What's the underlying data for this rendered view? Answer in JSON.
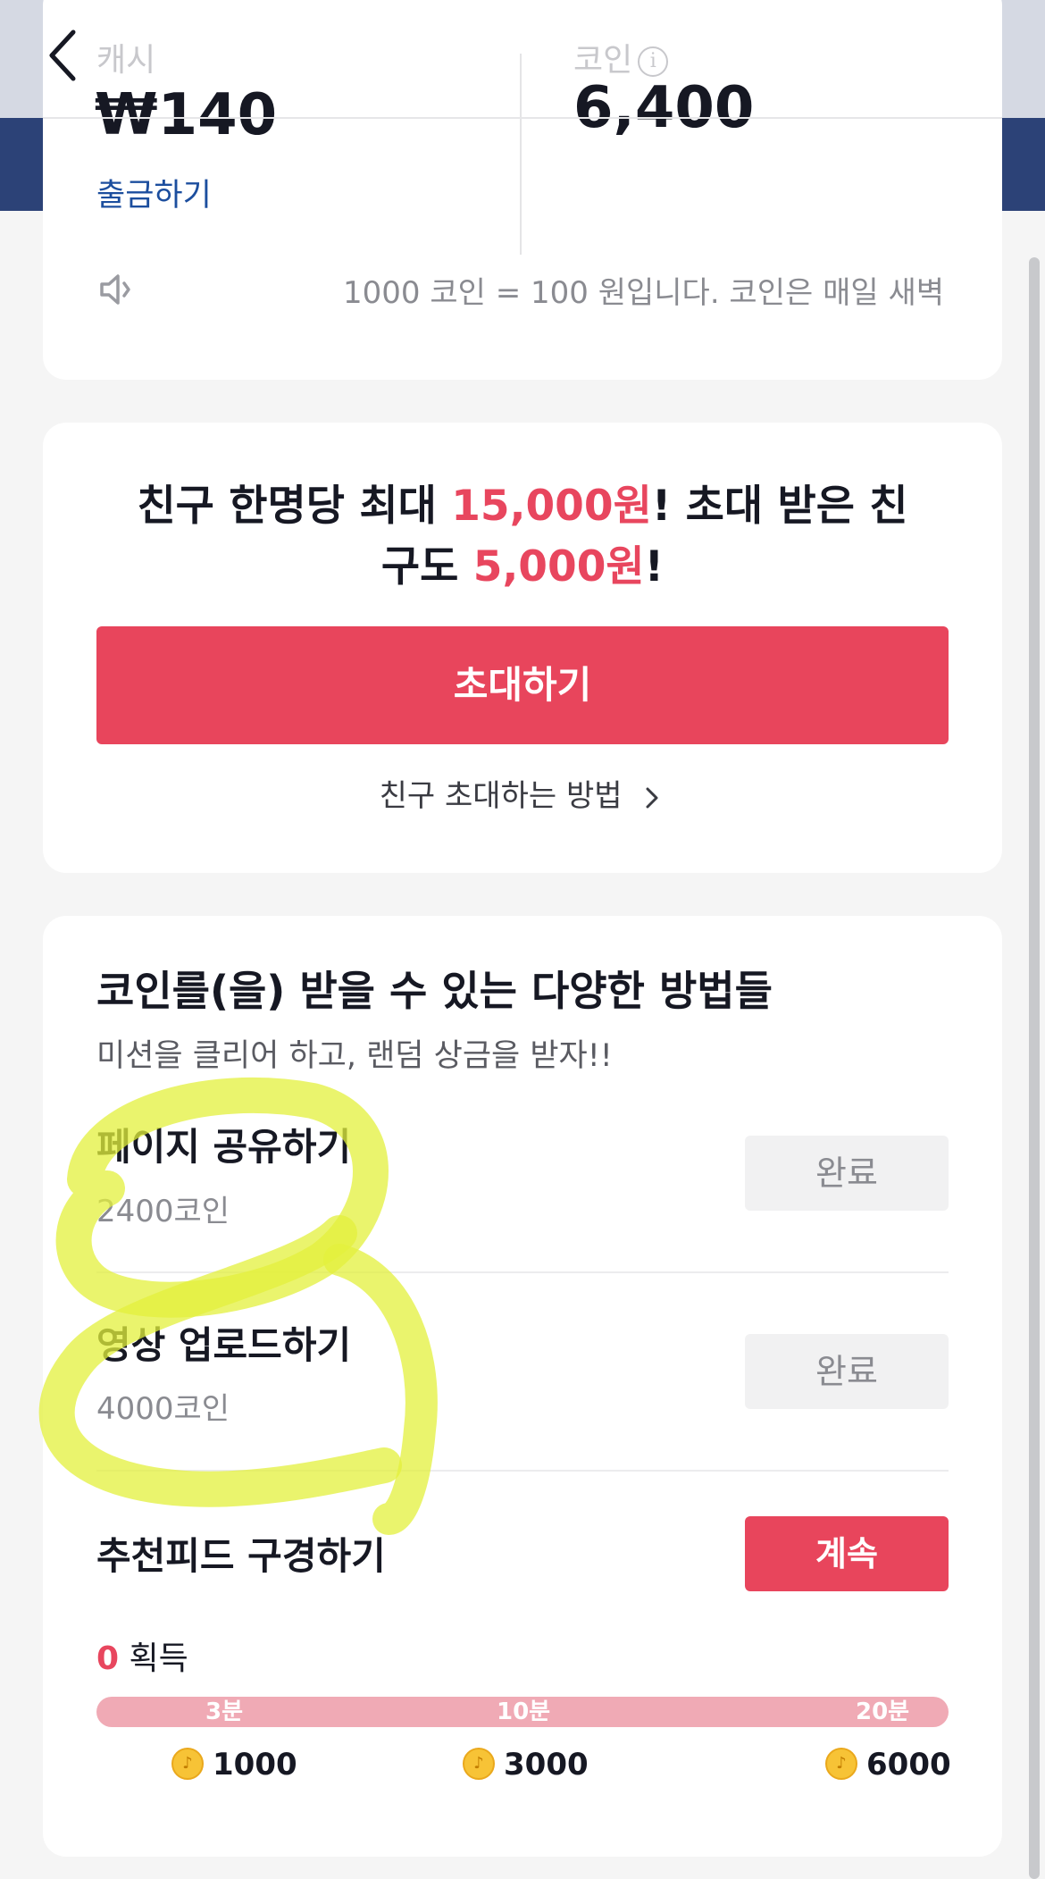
{
  "balance": {
    "cash_label": "캐시",
    "cash_value": "₩140",
    "withdraw_label": "출금하기",
    "coin_label": "코인",
    "coin_value": "6,400",
    "notice": "1000 코인 = 100 원입니다. 코인은 매일 새벽"
  },
  "invite": {
    "title_part1": "친구 한명당 최대 ",
    "title_amount1": "15,000원",
    "title_part2": "! 초대 받은 친",
    "title_part3": "구도 ",
    "title_amount2": "5,000원",
    "title_part4": "!",
    "button_label": "초대하기",
    "howto_label": "친구 초대하는 방법"
  },
  "missions": {
    "title": "코인를(을) 받을 수 있는 다양한 방법들",
    "subtitle": "미션을 클리어 하고, 랜덤 상금을 받자!!",
    "tasks": [
      {
        "name": "페이지 공유하기",
        "coins": "2400코인",
        "button": "완료"
      },
      {
        "name": "영상 업로드하기",
        "coins": "4000코인",
        "button": "완료"
      },
      {
        "name": "추천피드 구경하기",
        "button": "계속"
      }
    ],
    "earned_value": "0",
    "earned_label": "획득",
    "progress_fraction": 0,
    "milestones": [
      {
        "time": "3분",
        "reward": "1000"
      },
      {
        "time": "10분",
        "reward": "3000"
      },
      {
        "time": "20분",
        "reward": "6000"
      }
    ]
  },
  "icons": {
    "back": "chevron-left-icon",
    "info": "info-icon",
    "speaker": "speaker-icon",
    "chevron": "chevron-right-icon",
    "coin": "coin-icon"
  },
  "colors": {
    "accent_red": "#e8455c",
    "link_blue": "#1c4e9e",
    "highlight_yellow": "#e5f14a"
  }
}
